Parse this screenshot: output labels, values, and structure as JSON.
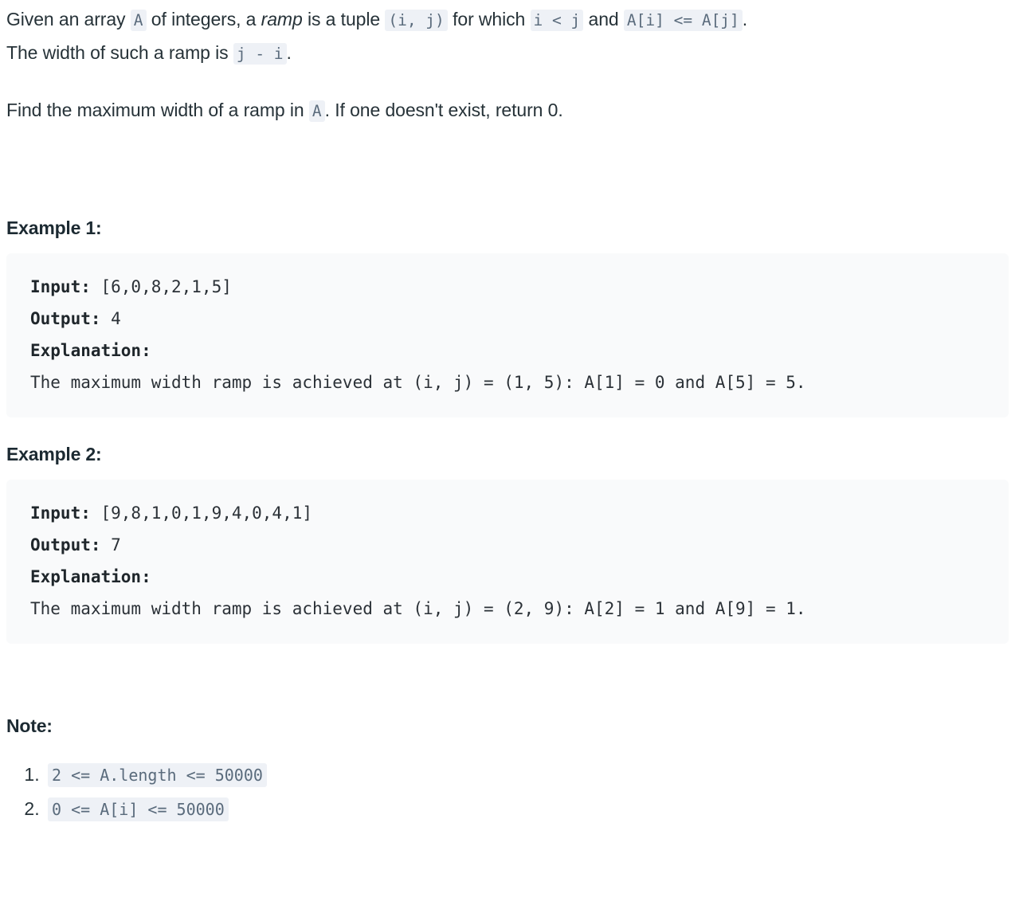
{
  "document": {
    "type": "problem-description",
    "colors": {
      "page_background": "#ffffff",
      "text": "#263238",
      "inline_code_background": "#eef1f6",
      "inline_code_text": "#5a6b7c",
      "code_block_background": "#f9fafb",
      "code_block_text": "#2b3137",
      "heading_text": "#1c2a32"
    },
    "intro": {
      "line1_part1": "Given an array",
      "code_A_1": "A",
      "line1_part2": "of integers, a",
      "emphasis_ramp": "ramp",
      "line1_part3": "is a tuple",
      "code_tuple": "(i, j)",
      "line1_part4": "for which",
      "code_iltj": "i < j",
      "line1_part5": "and",
      "code_ai_le_aj": "A[i] <= A[j]",
      "line1_part6": ".",
      "line2_part1": "The width of such a ramp is",
      "code_jmi": "j - i",
      "line2_part2": "."
    },
    "find": {
      "part1": "Find the maximum width of a ramp in",
      "code_A_2": "A",
      "part2": ". If one doesn't exist, return 0."
    },
    "examples": [
      {
        "heading": "Example 1:",
        "input_label": "Input:",
        "input_value": " [6,0,8,2,1,5]",
        "output_label": "Output:",
        "output_value": " 4",
        "explanation_label": "Explanation:",
        "explanation_text": "The maximum width ramp is achieved at (i, j) = (1, 5): A[1] = 0 and A[5] = 5."
      },
      {
        "heading": "Example 2:",
        "input_label": "Input:",
        "input_value": " [9,8,1,0,1,9,4,0,4,1]",
        "output_label": "Output:",
        "output_value": " 7",
        "explanation_label": "Explanation:",
        "explanation_text": "The maximum width ramp is achieved at (i, j) = (2, 9): A[2] = 1 and A[9] = 1."
      }
    ],
    "note": {
      "heading": "Note:",
      "items": [
        "2 <= A.length <= 50000",
        "0 <= A[i] <= 50000"
      ]
    }
  }
}
